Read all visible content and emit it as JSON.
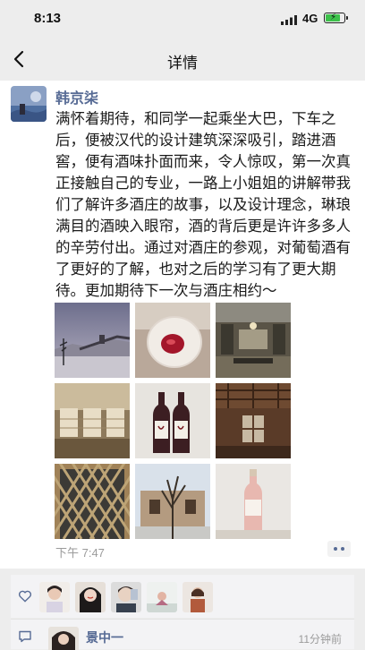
{
  "status_bar": {
    "time": "8:13",
    "network": "4G",
    "battery_level": 0.85
  },
  "nav": {
    "title": "详情",
    "back_icon": "chevron-left-icon"
  },
  "post": {
    "author": "韩京柒",
    "text": "满怀着期待，和同学一起乘坐大巴，下车之后，便被汉代的设计建筑深深吸引，踏进酒窖，便有酒味扑面而来，令人惊叹，第一次真正接触自己的专业，一路上小姐姐的讲解带我们了解许多酒庄的故事，以及设计理念，琳琅满目的酒映入眼帘，酒的背后更是许许多多人的辛劳付出。通过对酒庄的参观，对葡萄酒有了更好的了解，也对之后的学习有了更大期待。更加期待下一次与酒庄相约～",
    "emoji": "red-heart-icon",
    "photos": [
      "winter-wall-landscape-photo",
      "wine-glass-photo",
      "winery-hall-photo",
      "wine-cellar-photo",
      "wine-bottles-photo",
      "wooden-ceiling-window-photo",
      "lattice-wall-photo",
      "bare-tree-building-photo",
      "rose-wine-bottle-photo"
    ],
    "timestamp": "下午 7:47"
  },
  "likes": {
    "icon": "heart-outline-icon",
    "count_avatars": 5
  },
  "comments": [
    {
      "name": "景中一",
      "time": "11分钟前"
    }
  ],
  "colors": {
    "link": "#576b95",
    "background": "#ededed",
    "panel": "#f3f3f5"
  }
}
